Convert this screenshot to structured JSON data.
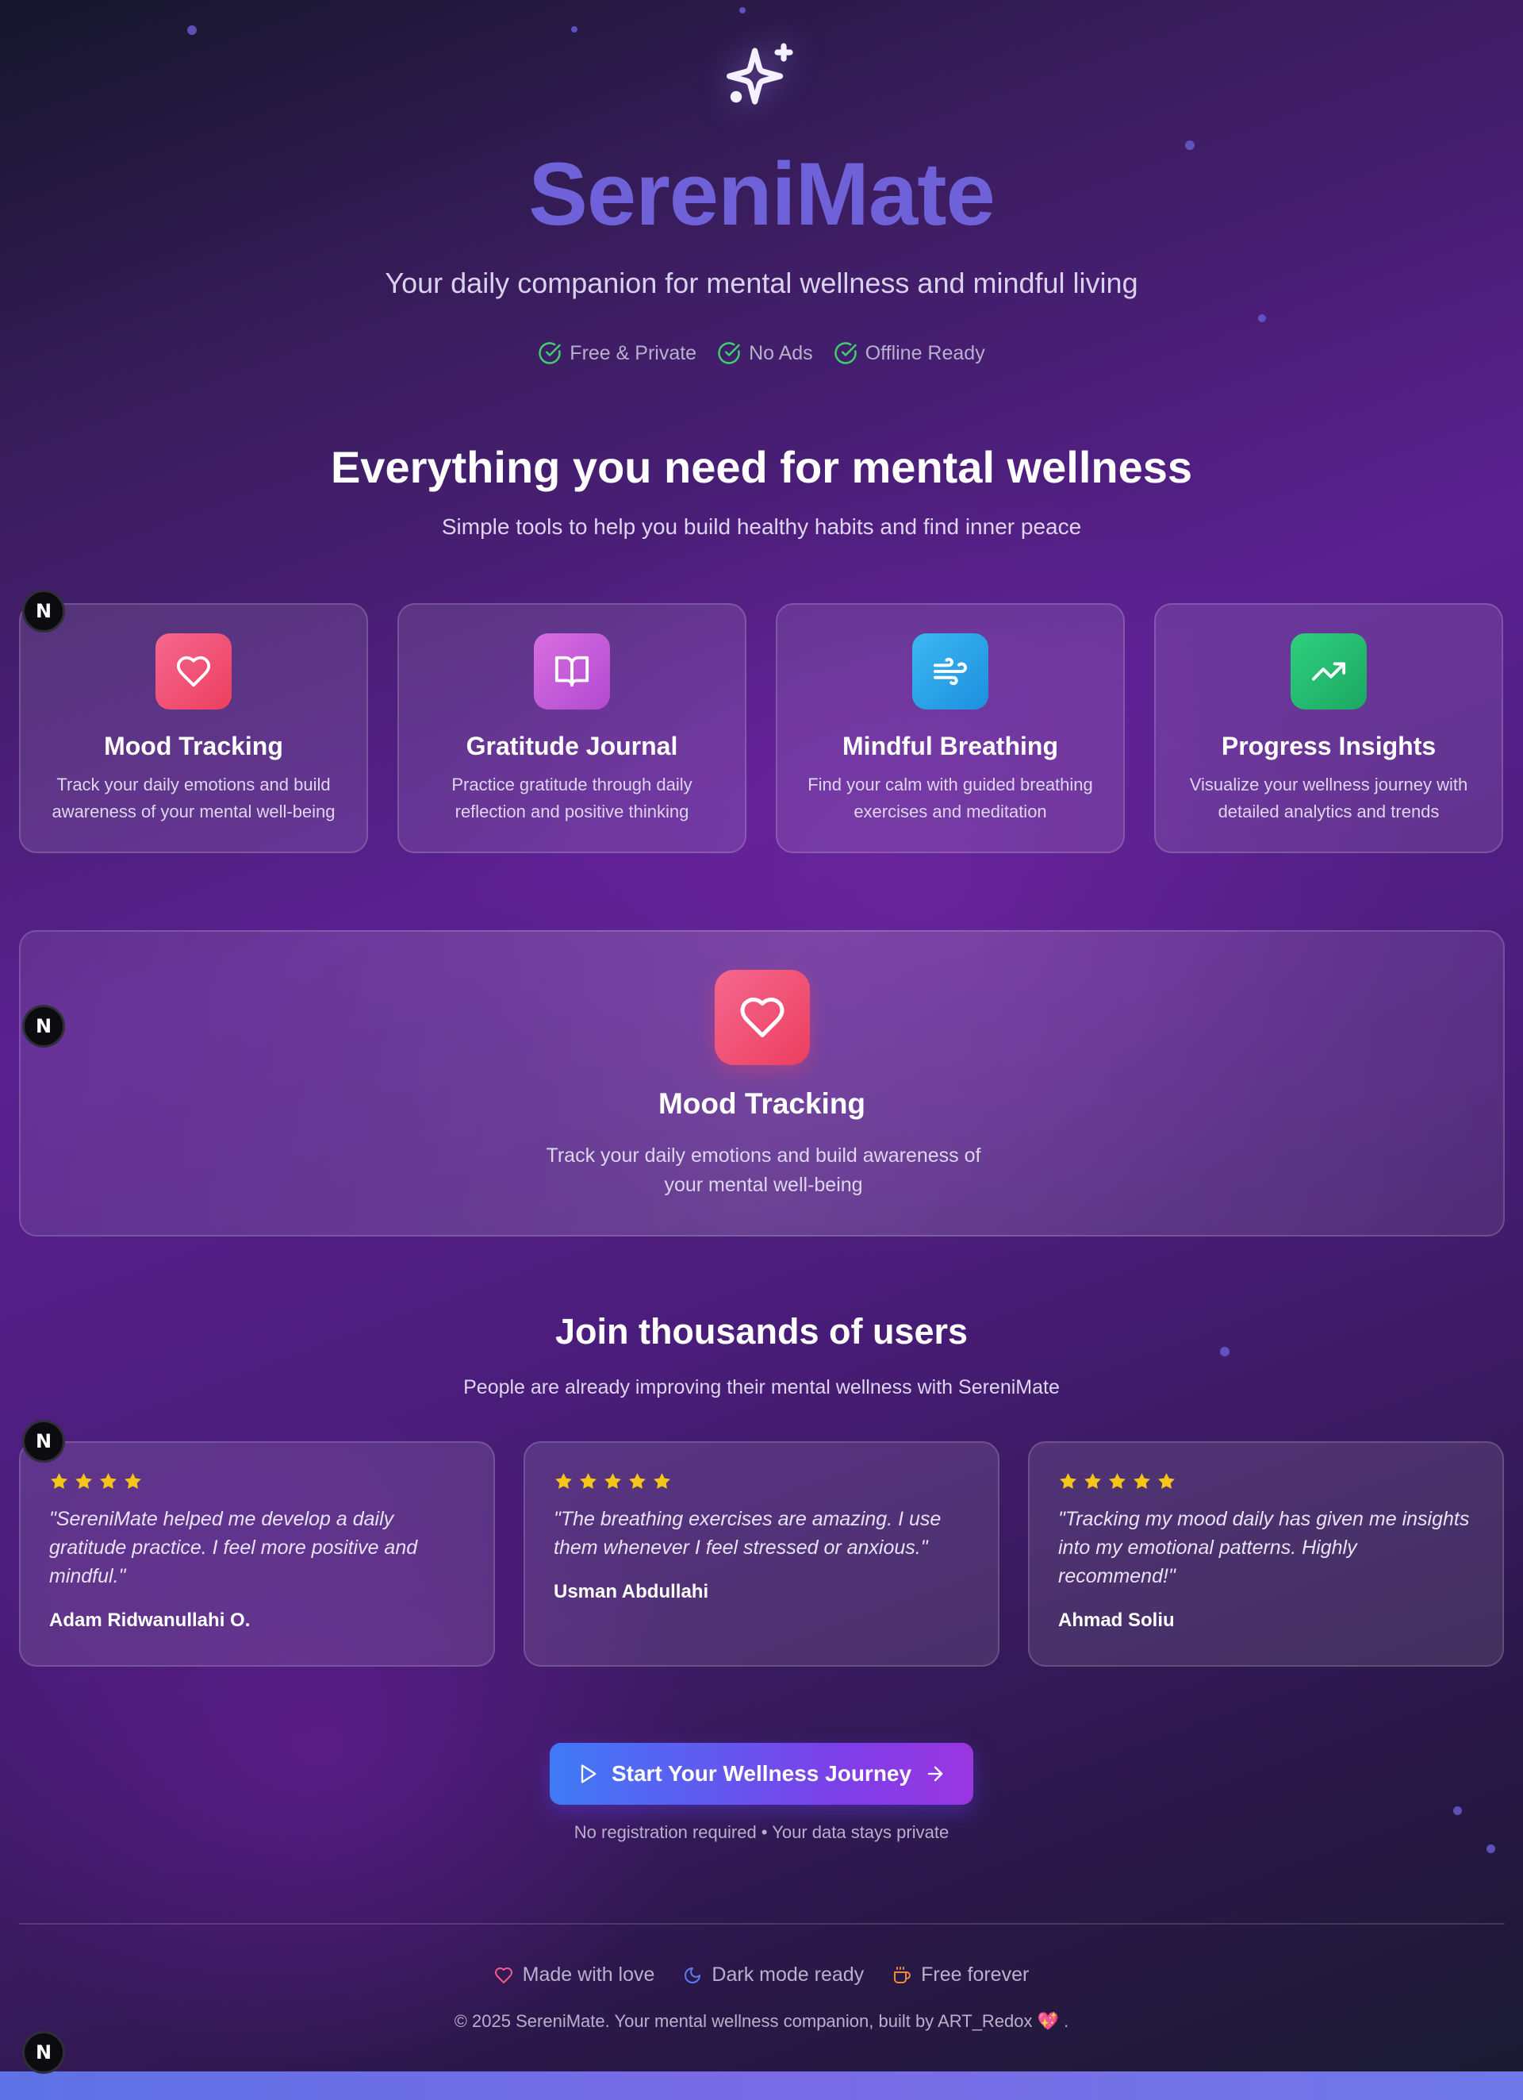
{
  "hero": {
    "brand": "SereniMate",
    "tagline": "Your daily companion for mental wellness and mindful living",
    "badges": [
      "Free & Private",
      "No Ads",
      "Offline Ready"
    ]
  },
  "features": {
    "title": "Everything you need for mental wellness",
    "subtitle": "Simple tools to help you build healthy habits and find inner peace",
    "items": [
      {
        "title": "Mood Tracking",
        "desc": "Track your daily emotions and build awareness of your mental well-being",
        "icon": "heart-icon",
        "color": "#f0517a"
      },
      {
        "title": "Gratitude Journal",
        "desc": "Practice gratitude through daily reflection and positive thinking",
        "icon": "book-open-icon",
        "color": "#c65ad9"
      },
      {
        "title": "Mindful Breathing",
        "desc": "Find your calm with guided breathing exercises and meditation",
        "icon": "wind-icon",
        "color": "#2aa7e6"
      },
      {
        "title": "Progress Insights",
        "desc": "Visualize your wellness journey with detailed analytics and trends",
        "icon": "trending-up-icon",
        "color": "#23b56d"
      }
    ],
    "highlight": {
      "title": "Mood Tracking",
      "desc": "Track your daily emotions and build awareness of your mental well-being",
      "icon": "heart-icon"
    }
  },
  "testimonials": {
    "title": "Join thousands of users",
    "subtitle": "People are already improving their mental wellness with SereniMate",
    "items": [
      {
        "stars": 4,
        "quote": "\"SereniMate helped me develop a daily gratitude practice. I feel more positive and mindful.\"",
        "author": "Adam Ridwanullahi O."
      },
      {
        "stars": 5,
        "quote": "\"The breathing exercises are amazing. I use them whenever I feel stressed or anxious.\"",
        "author": "Usman Abdullahi"
      },
      {
        "stars": 5,
        "quote": "\"Tracking my mood daily has given me insights into my emotional patterns. Highly recommend!\"",
        "author": "Ahmad Soliu"
      }
    ]
  },
  "cta": {
    "label": "Start Your Wellness Journey",
    "note": "No registration required • Your data stays private"
  },
  "footer": {
    "items": [
      "Made with love",
      "Dark mode ready",
      "Free forever"
    ],
    "copyright": "© 2025 SereniMate. Your mental wellness companion, built by ART_Redox 💖 ."
  },
  "dev_badge": "N",
  "colors": {
    "accent": "#6f62d8",
    "check": "#3ecf6e",
    "star": "#f5c518"
  }
}
